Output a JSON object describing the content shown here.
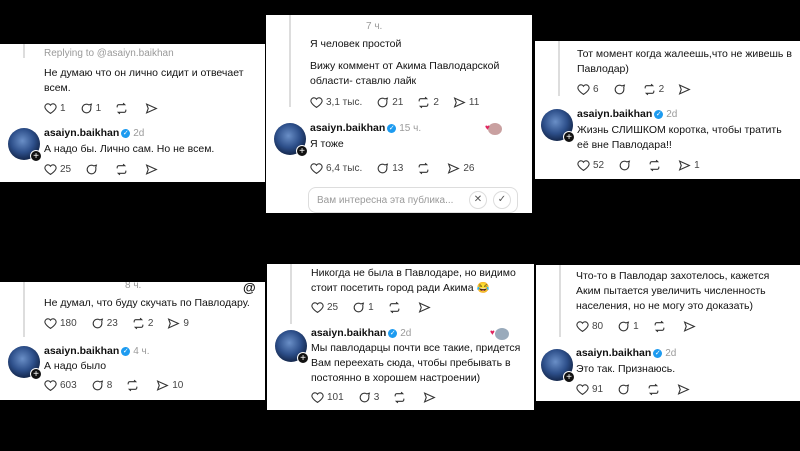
{
  "panels": {
    "p1": {
      "replying": "Replying to @asaiyn.baikhan",
      "comment_text": "Не думаю что он лично сидит и отвечает всем.",
      "comment_stats": {
        "likes": "1",
        "replies": "1"
      },
      "reply_user": "asaiyn.baikhan",
      "reply_time": "2d",
      "reply_text": "А надо бы. Лично сам. Но не всем.",
      "reply_stats": {
        "likes": "25"
      }
    },
    "p2": {
      "time": "7 ч.",
      "line1": "Я человек простой",
      "line2": "Вижу коммент от Акима Павлодарской области- ставлю лайк",
      "comment_stats": {
        "likes": "3,1 тыс.",
        "replies": "21",
        "reposts": "2",
        "shares": "11"
      },
      "reply_user": "asaiyn.baikhan",
      "reply_time": "15 ч.",
      "reply_text": "Я тоже",
      "reply_stats": {
        "likes": "6,4 тыс.",
        "replies": "13",
        "shares": "26"
      },
      "input_placeholder": "Вам интересна эта публика..."
    },
    "p3": {
      "comment_text": "Тот момент когда жалеешь,что не живешь в Павлодар)",
      "comment_stats": {
        "likes": "6",
        "reposts": "2"
      },
      "reply_user": "asaiyn.baikhan",
      "reply_time": "2d",
      "reply_text": "Жизнь СЛИШКОМ коротка, чтобы тратить её вне Павлодара!!",
      "reply_stats": {
        "likes": "52",
        "shares": "1"
      }
    },
    "p4": {
      "time": "8 ч.",
      "comment_text": "Не думал, что буду скучать по Павлодару.",
      "comment_stats": {
        "likes": "180",
        "replies": "23",
        "reposts": "2",
        "shares": "9"
      },
      "reply_user": "asaiyn.baikhan",
      "reply_time": "4 ч.",
      "reply_text": "А надо было",
      "reply_stats": {
        "likes": "603",
        "replies": "8",
        "shares": "10"
      }
    },
    "p5": {
      "comment_text": "Никогда не была в Павлодаре, но видимо стоит посетить город ради Акима 😂",
      "comment_stats": {
        "likes": "25",
        "replies": "1"
      },
      "reply_user": "asaiyn.baikhan",
      "reply_time": "2d",
      "reply_text": "Мы павлодарцы почти все такие, придется Вам переехать сюда, чтобы пребывать в постоянно в хорошем настроении)",
      "reply_stats": {
        "likes": "101",
        "replies": "3"
      }
    },
    "p6": {
      "comment_text": "Что-то в Павлодар захотелось,  кажется Аким пытается увеличить численность населения, но не могу это доказать)",
      "comment_stats": {
        "likes": "80",
        "replies": "1"
      },
      "reply_user": "asaiyn.baikhan",
      "reply_time": "2d",
      "reply_text": "Это так. Признаюсь.",
      "reply_stats": {
        "likes": "91"
      }
    }
  }
}
